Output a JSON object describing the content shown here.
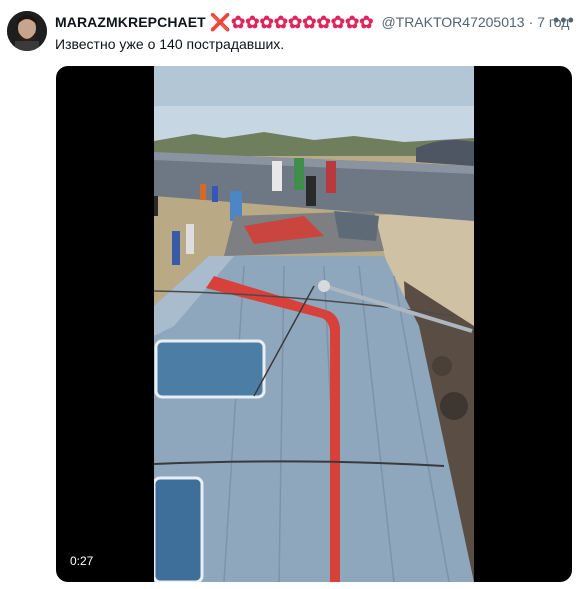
{
  "tweet": {
    "display_name": "MARAZMKREPCHAET",
    "badge_emoji": "❌✿✿✿✿✿✿✿✿✿✿",
    "handle": "@TRAKTOR47205013",
    "separator": "·",
    "timestamp": "7 год",
    "more_label": "•••",
    "text": "Известно уже о 140 пострадавших.",
    "media": {
      "duration": "0:27",
      "colors": {
        "train_roof": "#8fa7bd",
        "stripe": "#d8403a",
        "sky": "#c6d6e2",
        "ground": "#b9a985"
      }
    }
  }
}
